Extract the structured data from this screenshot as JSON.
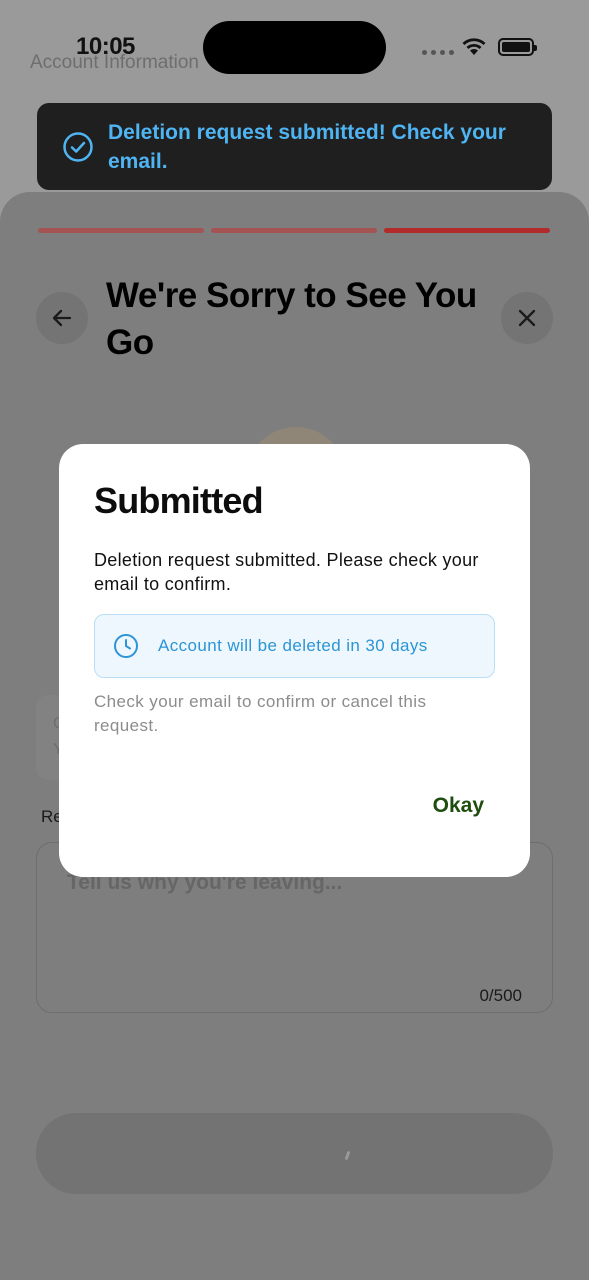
{
  "status_bar": {
    "time": "10:05"
  },
  "background_page": {
    "title": "Account Information"
  },
  "toast": {
    "message": "Deletion request submitted! Check your email."
  },
  "sheet": {
    "title": "We're Sorry to See You Go",
    "progress_colors": [
      "#a55454",
      "#a55454",
      "#b22a2a"
    ],
    "card_fragment_1": "C",
    "card_fragment_2": "Y",
    "reason_label_fragment": "Re",
    "reason_placeholder": "Tell us why you're leaving...",
    "char_count": "0/500"
  },
  "dialog": {
    "title": "Submitted",
    "body": "Deletion request submitted. Please check your email to confirm.",
    "info_text": "Account will be deleted in 30 days",
    "note": "Check your email to confirm or cancel this request.",
    "okay_label": "Okay"
  },
  "colors": {
    "accent_blue": "#2b95d6",
    "toast_text": "#4fb4f2",
    "okay_green": "#1f4d10",
    "progress_active": "#b22a2a"
  }
}
